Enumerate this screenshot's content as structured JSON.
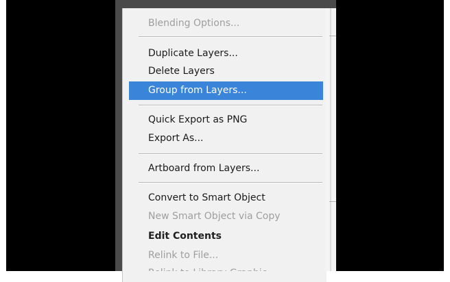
{
  "context_menu": {
    "items": [
      {
        "label": "Blending Options...",
        "state": "disabled"
      },
      {
        "label": "Duplicate Layers...",
        "state": "normal"
      },
      {
        "label": "Delete Layers",
        "state": "normal"
      },
      {
        "label": "Group from Layers...",
        "state": "highlighted"
      },
      {
        "label": "Quick Export as PNG",
        "state": "normal"
      },
      {
        "label": "Export As...",
        "state": "normal"
      },
      {
        "label": "Artboard from Layers...",
        "state": "normal"
      },
      {
        "label": "Convert to Smart Object",
        "state": "normal"
      },
      {
        "label": "New Smart Object via Copy",
        "state": "disabled"
      },
      {
        "label": "Edit Contents",
        "state": "normal"
      },
      {
        "label": "Relink to File...",
        "state": "disabled"
      },
      {
        "label": "Relink to Library Graphic...",
        "state": "disabled"
      }
    ]
  },
  "colors": {
    "highlight": "#3a84d9",
    "menu_background": "#f1f1f1",
    "disabled_text": "#9e9e9e",
    "frame_background": "#000000"
  }
}
